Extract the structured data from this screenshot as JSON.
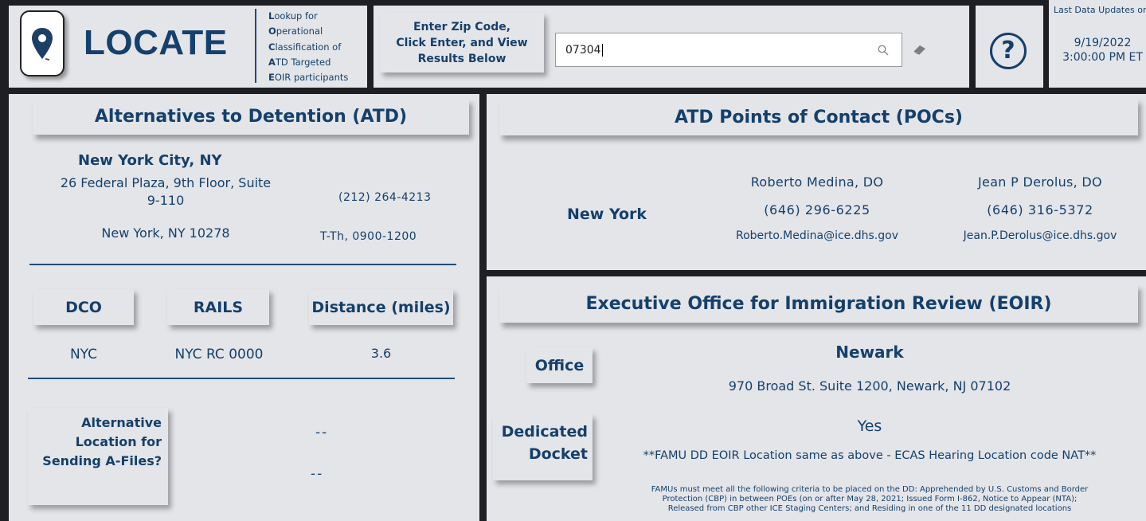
{
  "brand": {
    "name": "LOCATE",
    "acronym": [
      {
        "initial": "L",
        "rest": "ookup for"
      },
      {
        "initial": "O",
        "rest": "perational"
      },
      {
        "initial": "C",
        "rest": "lassification of"
      },
      {
        "initial": "A",
        "rest": "TD Targeted"
      },
      {
        "initial": "E",
        "rest": "OIR participants"
      }
    ]
  },
  "search": {
    "instruction_lines": [
      "Enter Zip Code,",
      "Click Enter, and View",
      "Results Below"
    ],
    "value": "07304"
  },
  "update": {
    "label": "Last Data Updates on",
    "date": "9/19/2022",
    "time": "3:00:00 PM ET"
  },
  "atd": {
    "title": "Alternatives to Detention (ATD)",
    "office_name": "New York City, NY",
    "address_line1": "26 Federal Plaza, 9th Floor, Suite",
    "address_line2": "9-110",
    "city_line": "New York, NY 10278",
    "phone": "(212) 264-4213",
    "hours": "T-Th, 0900-1200",
    "columns": {
      "dco": "DCO",
      "rails": "RAILS",
      "distance": "Distance (miles)"
    },
    "values": {
      "dco": "NYC",
      "rails": "NYC RC 0000",
      "distance": "3.6"
    },
    "alt_label": [
      "Alternative",
      "Location for",
      "Sending A-Files?"
    ],
    "alt_value1": "--",
    "alt_value2": "--"
  },
  "poc": {
    "title": "ATD Points of Contact (POCs)",
    "region": "New York",
    "contacts": [
      {
        "name": "Roberto Medina, DO",
        "phone": "(646) 296-6225",
        "email": "Roberto.Medina@ice.dhs.gov"
      },
      {
        "name": "Jean P Derolus, DO",
        "phone": "(646) 316-5372",
        "email": "Jean.P.Derolus@ice.dhs.gov"
      }
    ]
  },
  "eoir": {
    "title": "Executive Office for Immigration Review (EOIR)",
    "office_label": "Office",
    "office_name": "Newark",
    "office_address": "970 Broad St. Suite 1200, Newark, NJ 07102",
    "docket_label": [
      "Dedicated",
      "Docket"
    ],
    "docket_value": "Yes",
    "docket_note": "**FAMU DD EOIR Location same as above - ECAS Hearing Location code NAT**",
    "criteria_lines": [
      "FAMUs must meet all the following criteria to be placed on the DD: Apprehended by U.S. Customs and Border",
      "Protection (CBP) in between POEs (on or after May 28, 2021; Issued Form I-862, Notice to Appear (NTA);",
      "Released from CBP other ICE Staging Centers; and Residing in one of the 11 DD designated locations"
    ]
  },
  "colors": {
    "navy": "#14406b",
    "panel": "#e4e5e9",
    "background": "#1e1f24"
  }
}
